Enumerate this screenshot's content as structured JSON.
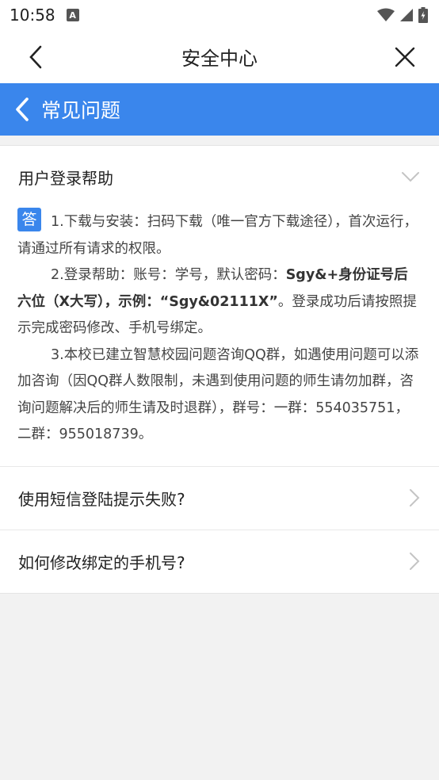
{
  "status_bar": {
    "time": "10:58",
    "notification_icon": "A"
  },
  "nav": {
    "title": "安全中心"
  },
  "faq_header": {
    "title": "常见问题"
  },
  "faq": {
    "expanded": {
      "question": "用户登录帮助",
      "badge": "答",
      "p1": "1.下载与安装：扫码下载（唯一官方下载途径），首次运行，请通过所有请求的权限。",
      "p2_pre": "2.登录帮助：账号：学号，默认密码：",
      "p2_bold": "Sgy&+身份证号后六位（X大写），示例：“Sgy&02111X”",
      "p2_post": "。登录成功后请按照提示完成密码修改、手机号绑定。",
      "p3": "3.本校已建立智慧校园问题咨询QQ群，如遇使用问题可以添加咨询（因QQ群人数限制，未遇到使用问题的师生请勿加群，咨询问题解决后的师生请及时退群），群号：一群：554035751，二群：955018739。"
    },
    "items": [
      {
        "question": "使用短信登陆提示失败?"
      },
      {
        "question": "如何修改绑定的手机号?"
      }
    ]
  }
}
